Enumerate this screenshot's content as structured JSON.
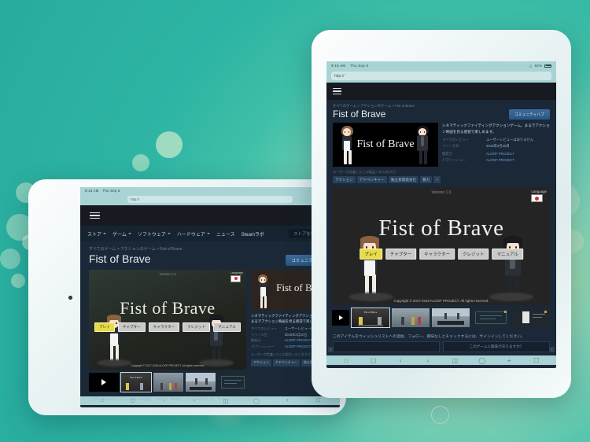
{
  "background": {
    "gradient_from": "#2fb5a4",
    "gradient_glow": "#f3e9a8",
    "note": "teal gradient with cream bokeh circles"
  },
  "devices": [
    {
      "name": "tablet-landscape-left",
      "orientation": "landscape",
      "frame_color": "#eaf4f5"
    },
    {
      "name": "tablet-portrait-right",
      "orientation": "portrait",
      "frame_color": "#f7fbfb"
    }
  ],
  "ios": {
    "status_time": "9:15 AM",
    "status_date": "Thu Sep 5",
    "status_wifi": "wifi-icon",
    "status_battery": "92%",
    "url_value": "http://",
    "url_placeholder": "http://",
    "toolbar_icons": [
      "share-icon",
      "bookmark-icon",
      "back-icon",
      "forward-icon",
      "tabs-icon",
      "history-icon",
      "newtab-icon",
      "pages-icon"
    ]
  },
  "store": {
    "menu_icon": "hamburger-icon",
    "nav": [
      {
        "label": "ストア",
        "has_caret": true
      },
      {
        "label": "ゲーム",
        "has_caret": true
      },
      {
        "label": "ソフトウェア",
        "has_caret": true
      },
      {
        "label": "ハードウェア",
        "has_caret": true
      },
      {
        "label": "ニュース",
        "has_caret": false
      },
      {
        "label": "Steamラボ",
        "has_caret": false
      }
    ],
    "search_placeholder": "ストアを検索する",
    "breadcrumb": "すべてのゲーム > アクションのゲーム > Fist of Brave",
    "page_title": "Fist of Brave",
    "hub_button": "コミュニティハブ",
    "description": "シネマティックファイティングアクションゲーム。まるでアクション映画を見る感覚で楽しめます。",
    "meta": [
      {
        "label": "すべてのレビュー",
        "value": "ユーザーレビューはありません",
        "link": false
      },
      {
        "label": "リリース日",
        "value": "2018年2月20日",
        "link": false
      },
      {
        "label": "開発元",
        "value": "ALOOF PROJECT",
        "link": true
      },
      {
        "label": "パブリッシャー",
        "value": "ALOOF PROJECT",
        "link": true
      }
    ],
    "tags_heading": "ユーザーが定義したこの製品への人気タグ:",
    "tags": [
      "アクション",
      "アドベンチャー",
      "独立系開発会社",
      "暴力",
      "+"
    ],
    "signin_notice": "このアイテムをウィッシュリストへの追加、フォロー、興味なしとチェックするには、サインインしてください。",
    "panel_left": "",
    "panel_right": "このゲームに興味がありますか？",
    "nav_arrow_left": "‹",
    "nav_arrow_right": "›"
  },
  "game": {
    "logo_text": "Fist of Brave",
    "version": "Version 1.0",
    "language_label": "Language",
    "language_flag": "japan-flag-icon",
    "menu": [
      {
        "label": "プレイ",
        "active": true
      },
      {
        "label": "チャプター",
        "active": false
      },
      {
        "label": "キャラクター",
        "active": false
      },
      {
        "label": "クレジット",
        "active": false
      },
      {
        "label": "マニュアル",
        "active": false
      }
    ],
    "copyright": "Copyright © 2017-2018 ALOOF PROJECT. All rights reserved.",
    "capsule_copyright": "Copyright © 2017-2018 ALOOF PROJECT. All rights reserved.",
    "characters": [
      {
        "name": "girl-character",
        "hair": "#8a6242",
        "outfit": "#2a2f38"
      },
      {
        "name": "boy-character",
        "hair": "#1c1c22",
        "outfit": "#30343c"
      }
    ]
  },
  "thumbnails": [
    {
      "name": "video-thumbnail",
      "type": "play"
    },
    {
      "name": "screenshot-1",
      "type": "image",
      "selected": true
    },
    {
      "name": "screenshot-2",
      "type": "image",
      "selected": false
    },
    {
      "name": "screenshot-3",
      "type": "image",
      "selected": false
    },
    {
      "name": "screenshot-4",
      "type": "image",
      "selected": false
    },
    {
      "name": "screenshot-5",
      "type": "image",
      "selected": false
    }
  ],
  "colors": {
    "steam_bg": "#1b2838",
    "steam_header": "#171a21",
    "accent_blue": "#67a5d8",
    "hub_button": "#3d6d9e",
    "ios_chrome": "#a9d3d4",
    "game_bg": "#242424",
    "menu_active": "#e6dc4a"
  }
}
